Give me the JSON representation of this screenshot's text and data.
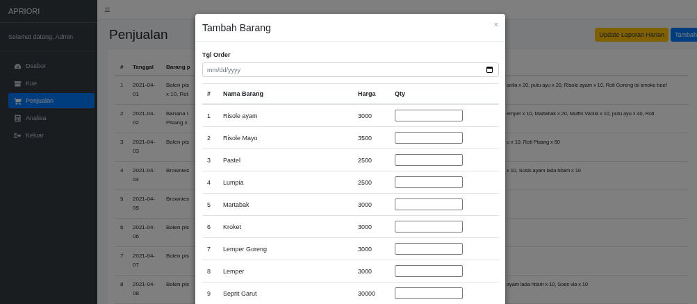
{
  "sidebar": {
    "brand": "APRIORI",
    "user": "Selamat datang, Admin",
    "items": [
      {
        "label": "Dasbor",
        "selected": false
      },
      {
        "label": "Kue",
        "selected": false
      },
      {
        "label": "Penjualan",
        "selected": true
      },
      {
        "label": "Analisa",
        "selected": false
      },
      {
        "label": "Keluar",
        "selected": false
      }
    ]
  },
  "topbar": {
    "menu_glyph": "≡"
  },
  "page": {
    "title": "Penjualan",
    "buttons": [
      {
        "label": "Update Laporan Harian",
        "kind": "warning"
      },
      {
        "label": "Tambah",
        "kind": "primary"
      }
    ]
  },
  "table": {
    "columns": [
      "#",
      "Tanggal",
      "Barang p"
    ],
    "rows": [
      {
        "no": "1",
        "date": "2021-04-01",
        "items_left": [
          "Bolen pis",
          "x 10, Rot"
        ],
        "items_right": [
          "anila x 20, putu ayu x 20, Risole ayam x 10, Roti Goreng isi smoke beef"
        ]
      },
      {
        "no": "2",
        "date": "2021-04-02",
        "items_left": [
          "Banana I",
          "Pisang x"
        ],
        "items_right": [
          "emper x 10, Martabak x 20, Muffin Vanila x 10, putu ayu x 40, Roti"
        ]
      },
      {
        "no": "3",
        "date": "2021-04-03",
        "items_left": [
          "Bolen pis"
        ],
        "items_right": [
          "u x 10, Roti Pisang x 50"
        ]
      },
      {
        "no": "4",
        "date": "2021-04-04",
        "items_left": [
          "Brownies"
        ],
        "items_right": [
          "x 10, Sosis ayam lada hitam x 10"
        ]
      },
      {
        "no": "5",
        "date": "2021-04-05",
        "items_left": [
          "Brownies"
        ],
        "items_right": []
      },
      {
        "no": "6",
        "date": "2021-04-06",
        "items_left": [
          "Bolen pis"
        ],
        "items_right": []
      },
      {
        "no": "7",
        "date": "2021-04-07",
        "items_left": [
          "Bolen pis"
        ],
        "items_right": []
      },
      {
        "no": "8",
        "date": "2021-04-08",
        "items_left": [
          "Bolen pis"
        ],
        "items_right": [
          "ayam lada hitam x 10, Soes vla x 10"
        ]
      }
    ]
  },
  "modal": {
    "title": "Tambah Barang",
    "close_glyph": "×",
    "date_label": "Tgl Order",
    "date_placeholder": "mm/dd/yyyy",
    "columns": [
      "#",
      "Nama Barang",
      "Harga",
      "Qty"
    ],
    "rows": [
      {
        "no": "1",
        "name": "Risole ayam",
        "price": "3000"
      },
      {
        "no": "2",
        "name": "Risole Mayo",
        "price": "3500"
      },
      {
        "no": "3",
        "name": "Pastel",
        "price": "2500"
      },
      {
        "no": "4",
        "name": "Lumpia",
        "price": "2500"
      },
      {
        "no": "5",
        "name": "Martabak",
        "price": "3000"
      },
      {
        "no": "6",
        "name": "Kroket",
        "price": "3000"
      },
      {
        "no": "7",
        "name": "Lemper Goreng",
        "price": "3000"
      },
      {
        "no": "8",
        "name": "Lemper",
        "price": "3000"
      },
      {
        "no": "9",
        "name": "Seprit Garut",
        "price": "30000"
      }
    ]
  }
}
